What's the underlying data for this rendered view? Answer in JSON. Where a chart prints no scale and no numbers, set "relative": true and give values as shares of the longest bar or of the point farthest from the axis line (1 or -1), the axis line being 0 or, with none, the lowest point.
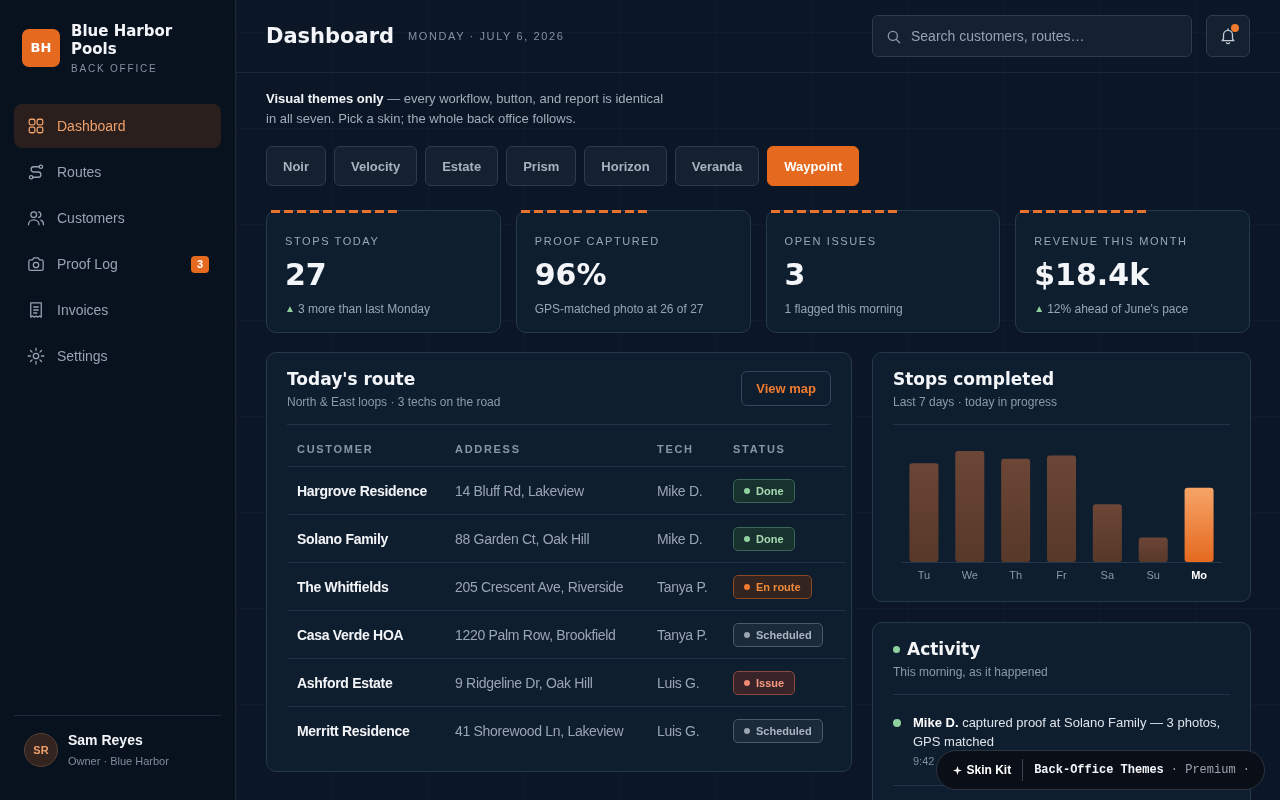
{
  "sidebar": {
    "brand": {
      "logo": "BH",
      "name": "Blue Harbor Pools",
      "tagline": "BACK OFFICE"
    },
    "nav": [
      {
        "label": "Dashboard",
        "selected": true
      },
      {
        "label": "Routes",
        "selected": false
      },
      {
        "label": "Customers",
        "selected": false
      },
      {
        "label": "Proof Log",
        "selected": false,
        "badge": "3"
      },
      {
        "label": "Invoices",
        "selected": false
      },
      {
        "label": "Settings",
        "selected": false
      }
    ],
    "user": {
      "initials": "SR",
      "name": "Sam Reyes",
      "role": "Owner · Blue Harbor"
    }
  },
  "header": {
    "title": "Dashboard",
    "date": "MONDAY · JULY 6, 2026",
    "search": {
      "placeholder": "Search customers, routes…"
    },
    "notifications": {
      "unread": true
    }
  },
  "intro": "**Visual themes only** — every workflow, button, and report is identical in all seven. Pick a skin; the whole back office follows.",
  "themes": [
    {
      "label": "Noir",
      "selected": false
    },
    {
      "label": "Velocity",
      "selected": false
    },
    {
      "label": "Estate",
      "selected": false
    },
    {
      "label": "Prism",
      "selected": false
    },
    {
      "label": "Horizon",
      "selected": false
    },
    {
      "label": "Veranda",
      "selected": false
    },
    {
      "label": "Waypoint",
      "selected": true
    }
  ],
  "kpis": [
    {
      "label": "STOPS TODAY",
      "value": "27",
      "trend": "▲",
      "note": "3 more than last Monday"
    },
    {
      "label": "PROOF CAPTURED",
      "value": "96%",
      "note": "GPS-matched photo at 26 of 27"
    },
    {
      "label": "OPEN ISSUES",
      "value": "3",
      "note": "1 flagged this morning"
    },
    {
      "label": "REVENUE THIS MONTH",
      "value": "$18.4k",
      "trend": "▲",
      "note": "12% ahead of June's pace"
    }
  ],
  "route": {
    "title": "Today's route",
    "subtitle": "North & East loops · 3 techs on the road",
    "action": "View map",
    "columns": [
      "CUSTOMER",
      "ADDRESS",
      "TECH",
      "STATUS"
    ],
    "rows": [
      {
        "customer": "Hargrove Residence",
        "address": "14 Bluff Rd, Lakeview",
        "tech": "Mike D.",
        "status": {
          "label": "Done",
          "kind": "done"
        }
      },
      {
        "customer": "Solano Family",
        "address": "88 Garden Ct, Oak Hill",
        "tech": "Mike D.",
        "status": {
          "label": "Done",
          "kind": "done"
        }
      },
      {
        "customer": "The Whitfields",
        "address": "205 Crescent Ave, Riverside",
        "tech": "Tanya P.",
        "status": {
          "label": "En route",
          "kind": "enroute"
        }
      },
      {
        "customer": "Casa Verde HOA",
        "address": "1220 Palm Row, Brookfield",
        "tech": "Tanya P.",
        "status": {
          "label": "Scheduled",
          "kind": "scheduled"
        }
      },
      {
        "customer": "Ashford Estate",
        "address": "9 Ridgeline Dr, Oak Hill",
        "tech": "Luis G.",
        "status": {
          "label": "Issue",
          "kind": "issue"
        }
      },
      {
        "customer": "Merritt Residence",
        "address": "41 Shorewood Ln, Lakeview",
        "tech": "Luis G.",
        "status": {
          "label": "Scheduled",
          "kind": "scheduled"
        }
      }
    ]
  },
  "stops": {
    "title": "Stops completed",
    "subtitle": "Last 7 days · today in progress",
    "chart_data": {
      "type": "bar",
      "categories": [
        "Tu",
        "We",
        "Th",
        "Fr",
        "Sa",
        "Su",
        "Mo"
      ],
      "values": [
        0.89,
        1,
        0.93,
        0.96,
        0.52,
        0.22,
        0.67
      ],
      "relative": true
    }
  },
  "activity": {
    "title": "Activity",
    "live": true,
    "subtitle": "This morning, as it happened",
    "items": [
      {
        "text": "**Mike D.** captured proof at Solano Family — 3 photos, GPS matched",
        "time": "9:42",
        "color": "#8fd19e"
      }
    ]
  },
  "promo": {
    "name": "Skin Kit",
    "product": "Back-Office Themes",
    "tier": "· Premium ·"
  }
}
